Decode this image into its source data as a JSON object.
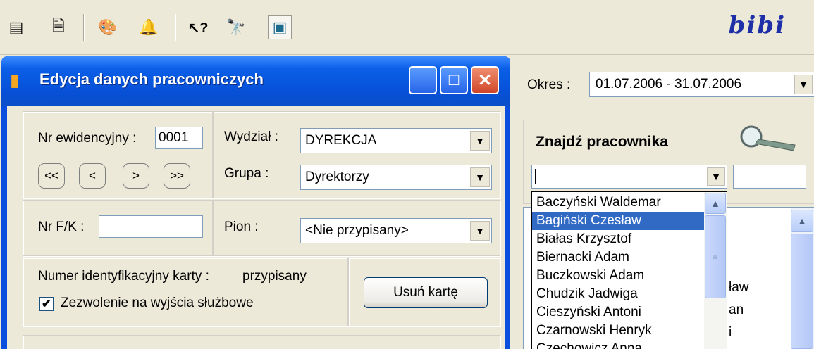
{
  "toolbar": {
    "buttons": [
      {
        "icon": "list-report-icon",
        "glyph": "▤"
      },
      {
        "icon": "document-export-icon",
        "glyph": "🗎"
      },
      {
        "icon": "palette-settings-icon",
        "glyph": "🎨"
      },
      {
        "icon": "bell-icon",
        "glyph": "🔔"
      },
      {
        "icon": "help-cursor-icon",
        "glyph": "↖?"
      },
      {
        "icon": "binoculars-icon",
        "glyph": "🔭"
      },
      {
        "icon": "window-layout-icon",
        "glyph": "▣"
      }
    ],
    "logo": "bibi"
  },
  "dialog": {
    "title": "Edycja danych pracowniczych",
    "min_glyph": "_",
    "max_glyph": "□",
    "close_glyph": "✕",
    "nr_ewid_label": "Nr ewidencyjny :",
    "nr_ewid_value": "0001",
    "nav": [
      "<<",
      "<",
      ">",
      ">>"
    ],
    "wydzial_label": "Wydział :",
    "wydzial_value": "DYREKCJA",
    "grupa_label": "Grupa :",
    "grupa_value": "Dyrektorzy",
    "nrfk_label": "Nr F/K :",
    "nrfk_value": "",
    "pion_label": "Pion :",
    "pion_value": "<Nie przypisany>",
    "karta_label": "Numer identyfikacyjny karty :",
    "karta_value": "przypisany",
    "usun_label": "Usuń kartę",
    "zezwolenie_label": "Zezwolenie na wyjścia służbowe",
    "zezwolenie_checked": true,
    "check_glyph": "✔",
    "arrow_glyph": "▼"
  },
  "right": {
    "okres_label": "Okres :",
    "okres_value": "01.07.2006 - 31.07.2006",
    "find_title": "Znajdź pracownika",
    "find_value": "",
    "find2_value": "",
    "bg_fragments": [
      "ław",
      "an",
      "i"
    ],
    "dropdown": {
      "items": [
        "Baczyński Waldemar",
        "Bagiński Czesław",
        "Białas Krzysztof",
        "Biernacki Adam",
        "Buczkowski Adam",
        "Chudzik Jadwiga",
        "Cieszyński Antoni",
        "Czarnowski Henryk",
        "Czechowicz Anna"
      ],
      "selected": "Bagiński Czesław"
    },
    "up_glyph": "▲",
    "thumb_glyph": "≡"
  }
}
